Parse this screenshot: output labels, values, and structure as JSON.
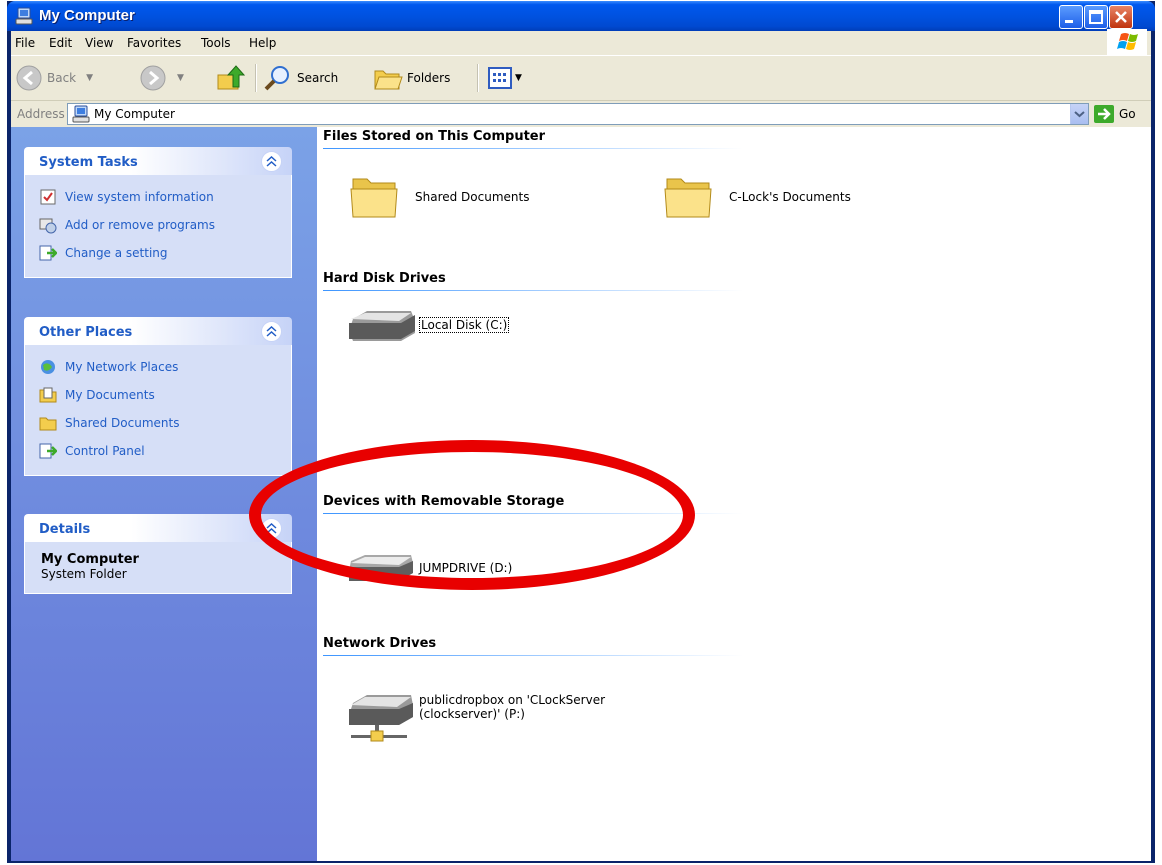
{
  "window": {
    "title": "My Computer"
  },
  "menu": {
    "file": "File",
    "edit": "Edit",
    "view": "View",
    "favorites": "Favorites",
    "tools": "Tools",
    "help": "Help"
  },
  "toolbar": {
    "back": "Back",
    "search": "Search",
    "folders": "Folders"
  },
  "address": {
    "label": "Address",
    "value": "My Computer",
    "go": "Go"
  },
  "panels": {
    "system_tasks": {
      "title": "System Tasks",
      "items": [
        "View system information",
        "Add or remove programs",
        "Change a setting"
      ]
    },
    "other_places": {
      "title": "Other Places",
      "items": [
        "My Network Places",
        "My Documents",
        "Shared Documents",
        "Control Panel"
      ]
    },
    "details": {
      "title": "Details",
      "name": "My Computer",
      "type": "System Folder"
    }
  },
  "groups": {
    "files": {
      "title": "Files Stored on This Computer",
      "items": [
        "Shared Documents",
        "C-Lock's Documents"
      ]
    },
    "hdd": {
      "title": "Hard Disk Drives",
      "items": [
        "Local Disk (C:)"
      ]
    },
    "removable": {
      "title": "Devices with Removable Storage",
      "items": [
        "JUMPDRIVE (D:)"
      ]
    },
    "network": {
      "title": "Network Drives",
      "items": [
        "publicdropbox on 'CLockServer",
        "(clockserver)' (P:)"
      ]
    }
  },
  "colors": {
    "title_bar": "#0058EE",
    "task_link": "#215DC6",
    "left_pane": "#7BA2E7",
    "highlight_ellipse": "#E80000"
  }
}
